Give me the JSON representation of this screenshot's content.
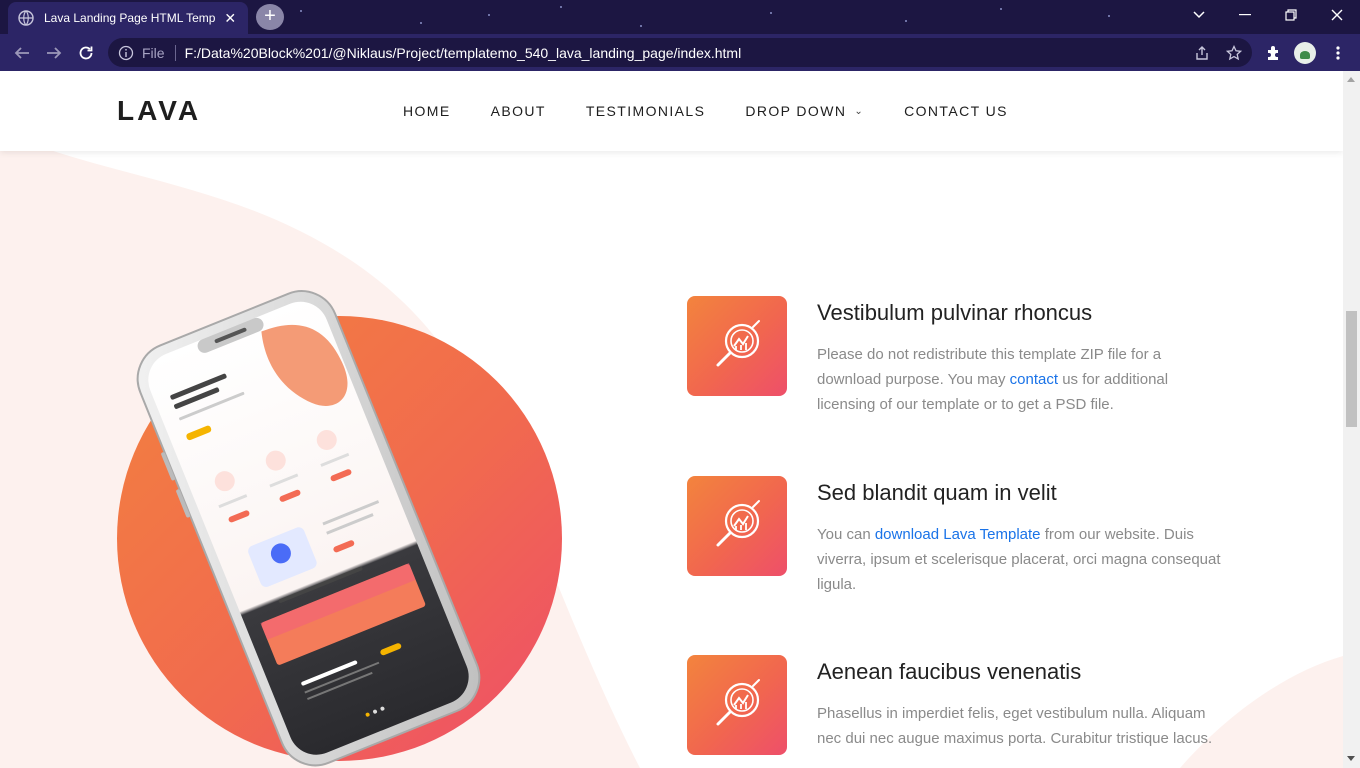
{
  "browser": {
    "tab_title": "Lava Landing Page HTML Template",
    "new_tab_symbol": "+",
    "address_scheme": "File",
    "address_url": "F:/Data%20Block%201/@Niklaus/Project/templatemo_540_lava_landing_page/index.html",
    "icons": [
      "globe-icon",
      "close-icon",
      "back-icon",
      "forward-icon",
      "reload-icon",
      "info-icon",
      "share-icon",
      "star-icon",
      "extensions-icon",
      "menu-icon"
    ]
  },
  "site": {
    "logo": "LAVA",
    "nav": [
      {
        "label": "HOME"
      },
      {
        "label": "ABOUT"
      },
      {
        "label": "TESTIMONIALS"
      },
      {
        "label": "DROP DOWN",
        "chevron": "⌄"
      },
      {
        "label": "CONTACT US"
      }
    ]
  },
  "features": [
    {
      "title": "Vestibulum pulvinar rhoncus",
      "text_before": "Please do not redistribute this template ZIP file for a download purpose. You may ",
      "link": "contact",
      "text_after": " us for additional licensing of our template or to get a PSD file."
    },
    {
      "title": "Sed blandit quam in velit",
      "text_before": "You can ",
      "link": "download Lava Template",
      "text_after": " from our website. Duis viverra, ipsum et scelerisque placerat, orci magna consequat ligula."
    },
    {
      "title": "Aenean faucibus venenatis",
      "text_before": "Phasellus in imperdiet felis, eget vestibulum nulla. Aliquam nec dui nec augue maximus porta. Curabitur tristique lacus.",
      "link": "",
      "text_after": ""
    }
  ],
  "colors": {
    "accent_orange": "#f3813f",
    "accent_pink": "#ee4d6a",
    "link": "#1a73e8",
    "browser_frame": "#1c1642"
  }
}
